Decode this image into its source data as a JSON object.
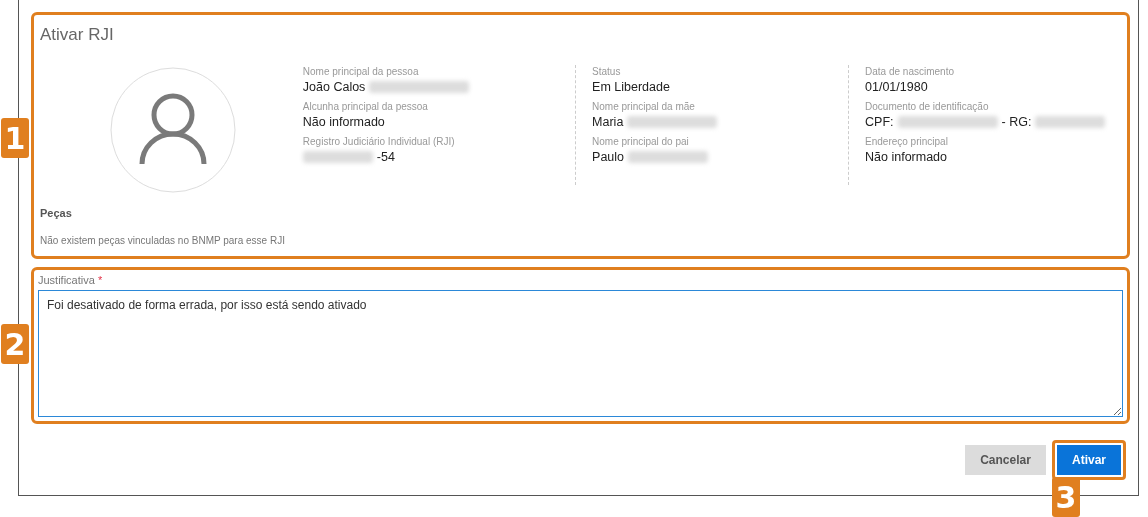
{
  "dialog": {
    "title": "Ativar RJI"
  },
  "person": {
    "columns": [
      [
        {
          "label": "Nome principal da pessoa",
          "value": [
            {
              "kind": "text",
              "text": "João Calos"
            },
            {
              "kind": "redacted"
            }
          ]
        },
        {
          "label": "Alcunha principal da pessoa",
          "value": [
            {
              "kind": "text",
              "text": "Não informado"
            }
          ]
        },
        {
          "label": "Registro Judiciário Individual (RJI)",
          "value": [
            {
              "kind": "redacted"
            },
            {
              "kind": "text",
              "text": "-54"
            }
          ]
        }
      ],
      [
        {
          "label": "Status",
          "value": [
            {
              "kind": "text",
              "text": "Em Liberdade"
            }
          ]
        },
        {
          "label": "Nome principal da mãe",
          "value": [
            {
              "kind": "text",
              "text": "Maria"
            },
            {
              "kind": "redacted"
            }
          ]
        },
        {
          "label": "Nome principal do pai",
          "value": [
            {
              "kind": "text",
              "text": "Paulo"
            },
            {
              "kind": "redacted"
            }
          ]
        }
      ],
      [
        {
          "label": "Data de nascimento",
          "value": [
            {
              "kind": "text",
              "text": "01/01/1980"
            }
          ]
        },
        {
          "label": "Documento de identificação",
          "value": [
            {
              "kind": "text",
              "text": "CPF:"
            },
            {
              "kind": "redacted"
            },
            {
              "kind": "text",
              "text": "- RG:"
            },
            {
              "kind": "redacted"
            }
          ]
        },
        {
          "label": "Endereço principal",
          "value": [
            {
              "kind": "text",
              "text": "Não informado"
            }
          ]
        }
      ]
    ]
  },
  "pieces": {
    "heading": "Peças",
    "message": "Não existem peças vinculadas no BNMP para esse RJI"
  },
  "justification": {
    "label": "Justificativa",
    "required_mark": "*",
    "value": "Foi desativado de forma errada, por isso está sendo ativado"
  },
  "buttons": [
    {
      "kind": "secondary",
      "label": "Cancelar"
    },
    {
      "kind": "primary",
      "label": "Ativar"
    }
  ],
  "callouts": [
    "1",
    "2",
    "3"
  ]
}
